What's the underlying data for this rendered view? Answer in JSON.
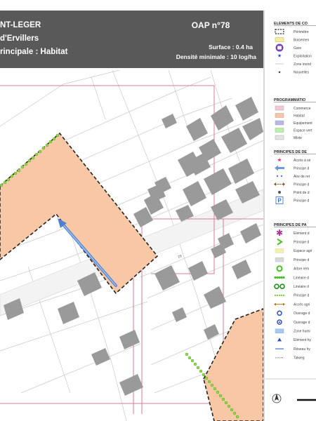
{
  "header": {
    "title_line1": "NT-LEGER",
    "title_line2": "d'Ervillers",
    "title_line3": "rincipale : Habitat",
    "oap_number": "OAP n°78",
    "surface": "Surface : 0.4 ha",
    "density": "Densité minimale : 10 log/ha"
  },
  "map": {
    "road_label": "29"
  },
  "legend": {
    "elements_title": "ELEMENTS DE CO",
    "elements": [
      {
        "icon": "dashed-perimeter-icon",
        "label": "Périmètre"
      },
      {
        "icon": "yellow-hatch-icon",
        "label": "Boisemen"
      },
      {
        "icon": "station-icon",
        "label": "Gare"
      },
      {
        "icon": "blue-star-icon",
        "label": "Exploitation"
      },
      {
        "icon": "zone-icon",
        "label": "Zone inond"
      },
      {
        "icon": "small-star-icon",
        "label": "Nouvelles"
      }
    ],
    "programmation_title": "PROGRAMMATIO",
    "programmation": [
      {
        "icon": "pink-swatch-icon",
        "label": "Commerce",
        "color": "#f4c9d6"
      },
      {
        "icon": "orange-swatch-icon",
        "label": "Habitat",
        "color": "#f7c6a3"
      },
      {
        "icon": "purple-swatch-icon",
        "label": "Equipement",
        "color": "#b9b7ea"
      },
      {
        "icon": "green-swatch-icon",
        "label": "Espace vert",
        "color": "#b7f2a6"
      },
      {
        "icon": "grey-swatch-icon",
        "label": "Mixte",
        "color": "#e3e3e3"
      }
    ],
    "desserte_title": "PRINCIPES DE DE",
    "desserte": [
      {
        "icon": "pink-star-icon",
        "label": "Accès à sé"
      },
      {
        "icon": "blue-arrow-icon",
        "label": "Principe d"
      },
      {
        "icon": "blue-dots-icon",
        "label": "Aire de ret"
      },
      {
        "icon": "brown-double-arrow-icon",
        "label": "Principe d"
      },
      {
        "icon": "point-icon",
        "label": "Point de d"
      },
      {
        "icon": "parking-icon",
        "label": "Principe d"
      }
    ],
    "paysage_title": "PRINCIPES DE PA",
    "paysage": [
      {
        "icon": "purple-asterisk-icon",
        "label": "Elément d"
      },
      {
        "icon": "green-chevron-icon",
        "label": "Principe d"
      },
      {
        "icon": "yellow-square-icon",
        "label": "Espace agri"
      },
      {
        "icon": "grey-square-icon",
        "label": "Principe d"
      },
      {
        "icon": "green-ring-icon",
        "label": "Arbre rem"
      },
      {
        "icon": "green-dot-line-icon",
        "label": "Linéaire d"
      },
      {
        "icon": "double-ring-icon",
        "label": "Linéaire d"
      },
      {
        "icon": "green-dots-icon",
        "label": "Principe d"
      },
      {
        "icon": "brown-arrow-icon",
        "label": "Accès agri"
      },
      {
        "icon": "blue-circle-icon",
        "label": "Ouvrage d"
      },
      {
        "icon": "blue-triangle-circle-icon",
        "label": "Ouvrage d"
      },
      {
        "icon": "blue-rect-icon",
        "label": "Zone humi"
      },
      {
        "icon": "blue-triangle-icon",
        "label": "Elément hy"
      },
      {
        "icon": "blue-line-icon",
        "label": "Réseau hy"
      },
      {
        "icon": "dotted-line-icon",
        "label": "Talweg"
      }
    ]
  }
}
